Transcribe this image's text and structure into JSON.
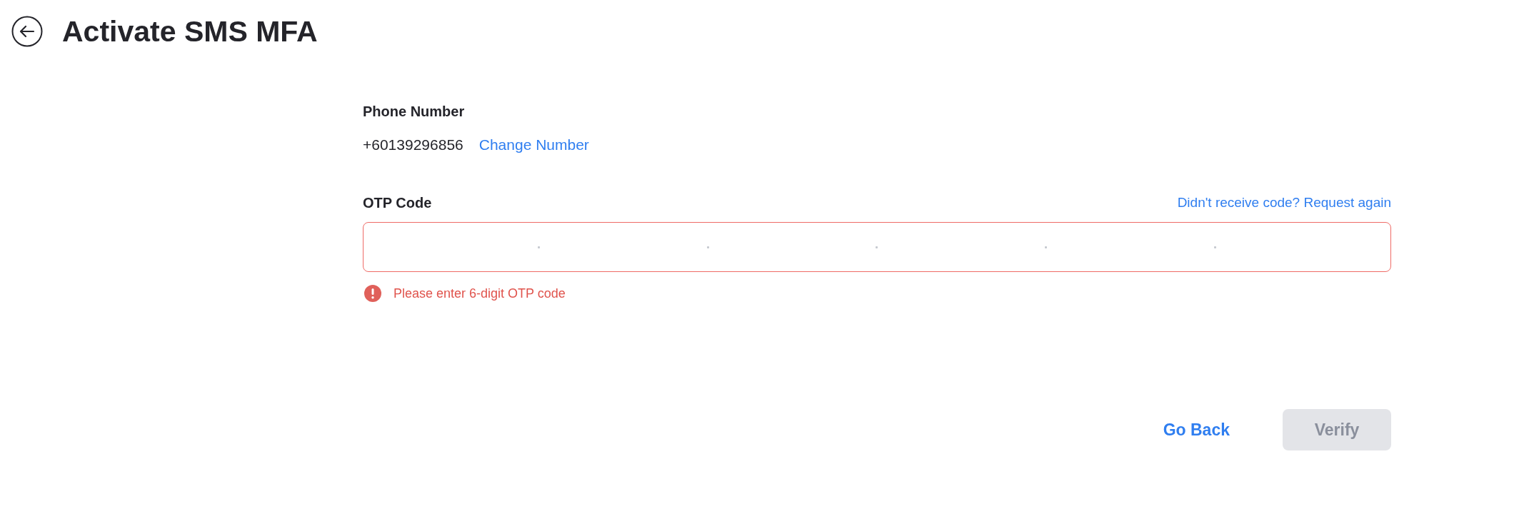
{
  "header": {
    "title": "Activate SMS MFA"
  },
  "phone": {
    "label": "Phone Number",
    "value": "+60139296856",
    "change_link": "Change Number"
  },
  "otp": {
    "label": "OTP Code",
    "resend_link": "Didn't receive code? Request again",
    "error": true,
    "error_message": "Please enter 6-digit OTP code"
  },
  "buttons": [
    {
      "kind": "link",
      "label": "Go Back",
      "disabled": false
    },
    {
      "kind": "primary",
      "label": "Verify",
      "disabled": true
    }
  ]
}
